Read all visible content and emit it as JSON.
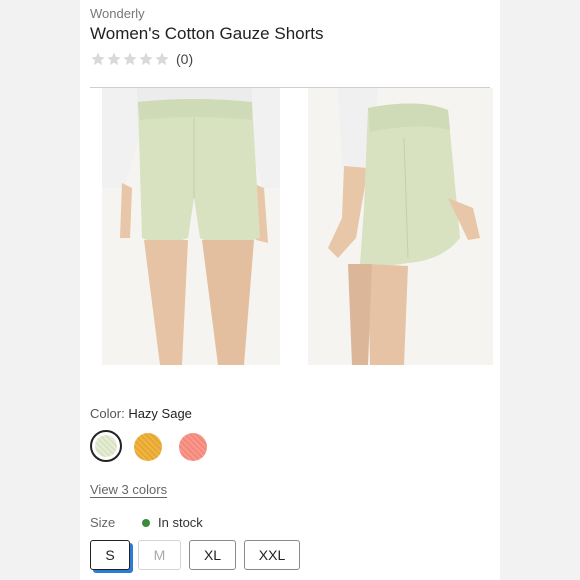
{
  "product": {
    "brand": "Wonderly",
    "title": "Women's Cotton Gauze Shorts",
    "rating_stars": 0,
    "review_count": "(0)"
  },
  "colors": {
    "label": "Color:",
    "selected": "Hazy Sage",
    "view_link": "View 3 colors",
    "swatch_colors": [
      "#dfe8cc",
      "#eeb03c",
      "#f6917f"
    ]
  },
  "sizes": {
    "label": "Size",
    "stock_status": "In stock",
    "options": [
      "S",
      "M",
      "XL",
      "XXL"
    ],
    "selected": "S",
    "unavailable": [
      "M"
    ]
  },
  "icons": [
    "star-icon",
    "swatch-hazy-sage",
    "swatch-gold",
    "swatch-coral"
  ]
}
